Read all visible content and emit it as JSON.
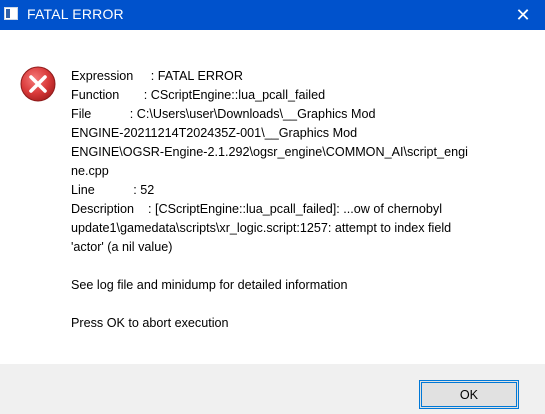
{
  "window": {
    "title": "FATAL ERROR",
    "close_glyph": "✕"
  },
  "icons": {
    "app": "window-icon",
    "error": "error-x-icon",
    "error_color": "#d93a3a"
  },
  "message": {
    "expression": "Expression     : FATAL ERROR",
    "function": "Function       : CScriptEngine::lua_pcall_failed",
    "file_line1": "File           : C:\\Users\\user\\Downloads\\__Graphics Mod",
    "file_line2": "ENGINE-20211214T202435Z-001\\__Graphics Mod",
    "file_line3": "ENGINE\\OGSR-Engine-2.1.292\\ogsr_engine\\COMMON_AI\\script_engi",
    "file_line4": "ne.cpp",
    "line": "Line           : 52",
    "description_line1": "Description    : [CScriptEngine::lua_pcall_failed]: ...ow of chernobyl",
    "description_line2": "update1\\gamedata\\scripts\\xr_logic.script:1257: attempt to index field",
    "description_line3": "'actor' (a nil value)",
    "see_log": "See log file and minidump for detailed information",
    "press_ok": "Press OK to abort execution"
  },
  "buttons": {
    "ok": "OK"
  },
  "colors": {
    "titlebar": "#0052cc",
    "footer": "#f0f0f0",
    "button_border": "#0078d7"
  }
}
